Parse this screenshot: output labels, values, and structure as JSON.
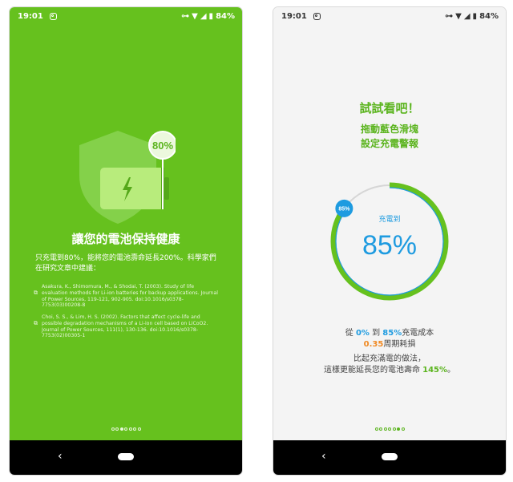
{
  "status": {
    "time": "19:01",
    "battery": "84%"
  },
  "screen1": {
    "title": "讓您的電池保持健康",
    "body": "只充電到80%，能將您的電池壽命延長200%。科學家們在研究文章中建議：",
    "badge": "80%",
    "references": [
      "Asakura, K., Shimomura, M., & Shodai, T. (2003). Study of life evaluation methods for Li-ion batteries for backup applications. Journal of Power Sources, 119-121, 902-905. doi:10.1016/s0378-7753(03)00208-8",
      "Choi, S. S., & Lim, H. S. (2002). Factors that affect cycle-life and possible degradation mechanisms of a Li-ion cell based on LiCoO2. Journal of Power Sources, 111(1), 130-136. doi:10.1016/s0378-7753(02)00305-1"
    ],
    "page_index": 2,
    "page_count": 7
  },
  "screen2": {
    "title": "試試看吧！",
    "subtitle_1": "拖動藍色滑塊",
    "subtitle_2": "設定充電警報",
    "gauge_label": "充電到",
    "gauge_value": "85%",
    "slider_badge": "85%",
    "gauge_fraction": 0.85,
    "line1_prefix": "從",
    "line1_from": "0%",
    "line1_mid": "到",
    "line1_to": "85%",
    "line1_suffix": "充電成本",
    "line2_value": "0.35",
    "line2_suffix": "周期耗損",
    "line3": "比起充滿電的做法，",
    "line4_prefix": "這樣更能延長您的電池壽命",
    "line4_value": "145%",
    "line4_suffix": "。",
    "page_index": 5,
    "page_count": 7
  },
  "colors": {
    "green": "#66c11e",
    "accent_green": "#5bb41e",
    "blue": "#1e9be0",
    "orange": "#f08a24"
  }
}
